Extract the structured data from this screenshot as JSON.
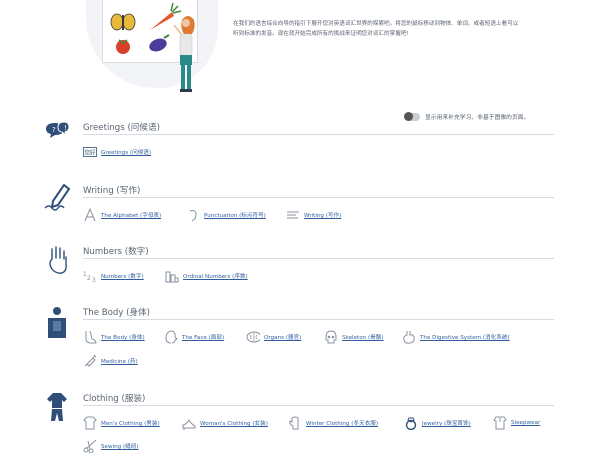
{
  "intro": {
    "text": "在我们的语言综合向导的指引下展开您对英语词汇世界的探索吧。将您的鼠标移动到物体、单词、或者短语上看可以听到标准的发音。现在就开始完成所有的挑战来证明您对词汇的掌握吧!"
  },
  "toggle": {
    "label": "显示用来补充学习、非基于图像的页面。"
  },
  "colors": {
    "icon_blue": "#2f4f78",
    "link_blue": "#2f5fa0",
    "rule": "#d7dce2"
  },
  "sections": [
    {
      "title": "Greetings (问候语)",
      "icon": "speech-bubbles-icon",
      "items": [
        {
          "label": "Greetings (问候语)",
          "icon": "hello-card-icon",
          "icon_text": "您好"
        }
      ]
    },
    {
      "title": "Writing (写作)",
      "icon": "pen-writing-icon",
      "items": [
        {
          "label": "The Alphabet (字母表)",
          "icon": "alphabet-icon"
        },
        {
          "label": "Punctuation (标点符号)",
          "icon": "punctuation-icon"
        },
        {
          "label": "Writing (写作)",
          "icon": "writing-lines-icon"
        }
      ]
    },
    {
      "title": "Numbers (数字)",
      "icon": "counting-hand-icon",
      "items": [
        {
          "label": "Numbers (数字)",
          "icon": "numbers-icon"
        },
        {
          "label": "Ordinal Numbers (序数)",
          "icon": "ordinal-bars-icon"
        }
      ]
    },
    {
      "title": "The Body (身体)",
      "icon": "body-torso-icon",
      "items": [
        {
          "label": "The Body (身体)",
          "icon": "foot-icon"
        },
        {
          "label": "The Face (面部)",
          "icon": "face-profile-icon"
        },
        {
          "label": "Organs (器官)",
          "icon": "brain-icon"
        },
        {
          "label": "Skeleton (骨骼)",
          "icon": "skull-icon"
        },
        {
          "label": "The Digestive System (消化系统)",
          "icon": "stomach-icon"
        },
        {
          "label": "Medicine (药)",
          "icon": "syringe-icon"
        }
      ]
    },
    {
      "title": "Clothing (服装)",
      "icon": "clothing-icon",
      "items": [
        {
          "label": "Men's Clothing (男装)",
          "icon": "mens-shirt-icon"
        },
        {
          "label": "Woman's Clothing (女装)",
          "icon": "womens-shoe-icon"
        },
        {
          "label": "Winter Clothing (冬天衣服)",
          "icon": "winter-mitten-icon"
        },
        {
          "label": "Jewelry (珠宝首饰)",
          "icon": "ring-icon"
        },
        {
          "label": "Sleepwear",
          "icon": "sleepwear-icon"
        },
        {
          "label": "Sewing (缝纫)",
          "icon": "scissors-icon"
        }
      ]
    }
  ]
}
